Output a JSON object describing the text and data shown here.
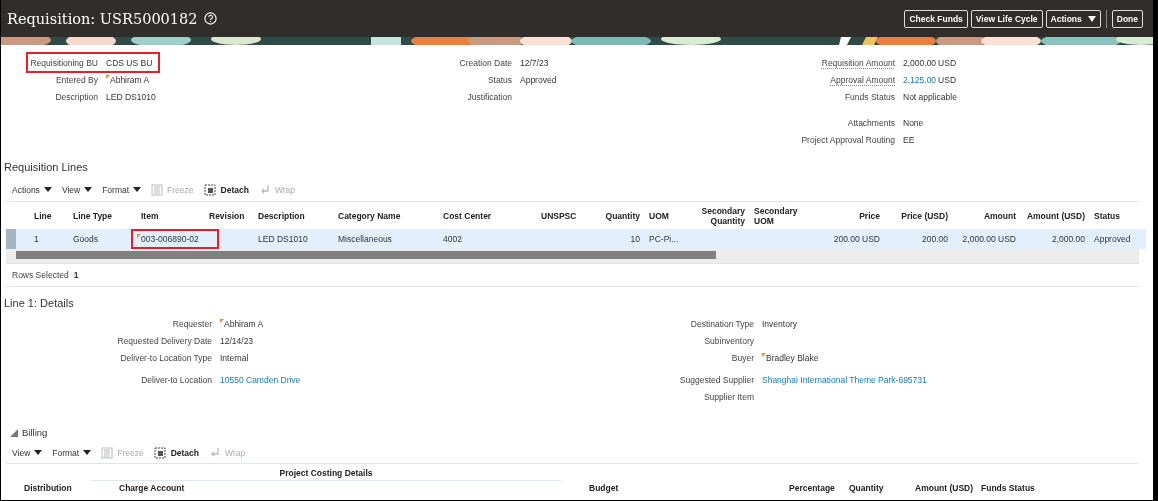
{
  "header": {
    "title": "Requisition: USR5000182",
    "buttons": [
      {
        "label": "Check Funds",
        "kind": "button"
      },
      {
        "label": "View Life Cycle",
        "kind": "button"
      },
      {
        "label": "Actions",
        "kind": "menu"
      },
      {
        "label": "Done",
        "kind": "button"
      }
    ]
  },
  "summary": {
    "columns": [
      [
        [
          {
            "label": "Requisitioning BU",
            "value": "CDS US BU",
            "kind": "text",
            "highlighted": true
          },
          {
            "label": "Entered By",
            "value": "Abhiram A",
            "kind": "person",
            "highlighted": false
          },
          {
            "label": "Description",
            "value": "LED DS1010",
            "kind": "text",
            "highlighted": false
          }
        ]
      ],
      [
        [
          {
            "label": "Creation Date",
            "value": "12/7/23",
            "kind": "text",
            "highlighted": false
          },
          {
            "label": "Status",
            "value": "Approved",
            "kind": "text",
            "highlighted": false
          },
          {
            "label": "Justification",
            "highlighted": false
          }
        ]
      ],
      [
        [
          {
            "label": "Requisition Amount",
            "value": "2,000.00",
            "currency": "USD",
            "kind": "amount",
            "hint": true,
            "highlighted": false
          },
          {
            "label": "Approval Amount",
            "value": "2,125.00",
            "currency": "USD",
            "kind": "amount_link",
            "hint": true,
            "highlighted": false
          },
          {
            "label": "Funds Status",
            "value": "Not applicable",
            "kind": "text",
            "highlighted": false
          }
        ],
        [
          {
            "label": "Attachments",
            "value": "None",
            "kind": "text",
            "highlighted": false
          },
          {
            "label": "Project Approval Routing",
            "value": "EE",
            "kind": "text",
            "highlighted": false
          }
        ]
      ]
    ]
  },
  "lines": {
    "title": "Requisition Lines",
    "toolbar": [
      {
        "label": "Actions",
        "kind": "menu",
        "disabled": false
      },
      {
        "label": "View",
        "kind": "menu",
        "disabled": false
      },
      {
        "label": "Format",
        "kind": "menu",
        "disabled": false
      },
      {
        "label": "Freeze",
        "kind": "freeze",
        "disabled": true
      },
      {
        "label": "Detach",
        "kind": "detach",
        "disabled": false
      },
      {
        "label": "Wrap",
        "kind": "wrap",
        "disabled": true
      }
    ],
    "columns": [
      {
        "label": "Line",
        "numeric": false
      },
      {
        "label": "Line Type",
        "numeric": false
      },
      {
        "label": "Item",
        "numeric": false
      },
      {
        "label": "Revision",
        "numeric": false
      },
      {
        "label": "Description",
        "numeric": false
      },
      {
        "label": "Category Name",
        "numeric": false
      },
      {
        "label": "Cost Center",
        "numeric": false
      },
      {
        "label": "UNSPSC",
        "numeric": false
      },
      {
        "label": "Quantity",
        "numeric": true
      },
      {
        "label": "UOM",
        "numeric": false
      },
      {
        "label": "Secondary Quantity",
        "numeric": true
      },
      {
        "label": "Secondary UOM",
        "numeric": false
      },
      {
        "label": "Price",
        "numeric": true
      },
      {
        "label": "Price (USD)",
        "numeric": true
      },
      {
        "label": "Amount",
        "numeric": true
      },
      {
        "label": "Amount (USD)",
        "numeric": true
      },
      {
        "label": "Status",
        "numeric": false
      }
    ],
    "rows": [
      {
        "selected": true,
        "cells": [
          {
            "text": "1"
          },
          {
            "text": "Goods"
          },
          {
            "text": "003-006890-02",
            "kind": "flagged",
            "highlighted": true
          },
          {},
          {
            "text": "LED DS1010"
          },
          {
            "text": "Miscellaneous"
          },
          {
            "text": "4002"
          },
          {},
          {
            "text": "10"
          },
          {
            "text": "PC-Pi..."
          },
          {},
          {},
          {
            "text": "200.00 USD"
          },
          {
            "text": "200.00"
          },
          {
            "text": "2,000.00 USD"
          },
          {
            "text": "2,000.00"
          },
          {
            "text": "Approved"
          }
        ]
      }
    ],
    "rows_selected": {
      "label": "Rows Selected",
      "value": "1"
    }
  },
  "details": {
    "title": "Line 1: Details",
    "columns": [
      [
        [
          {
            "label": "Requester",
            "value": "Abhiram A",
            "kind": "person",
            "highlighted": false
          },
          {
            "label": "Requested Delivery Date",
            "value": "12/14/23",
            "kind": "text",
            "highlighted": false
          },
          {
            "label": "Deliver-to Location Type",
            "value": "Internal",
            "kind": "text",
            "highlighted": false
          }
        ],
        [
          {
            "label": "Deliver-to Location",
            "value": "10550 Camden Drive",
            "kind": "link",
            "highlighted": false
          }
        ]
      ],
      [
        [
          {
            "label": "Destination Type",
            "value": "Inventory",
            "kind": "text",
            "highlighted": false
          },
          {
            "label": "Subinventory",
            "highlighted": false
          },
          {
            "label": "Buyer",
            "value": "Bradley Blake",
            "kind": "person",
            "highlighted": false
          }
        ],
        [
          {
            "label": "Suggested Supplier",
            "value": "Shanghai International Theme Park-695731",
            "kind": "link",
            "highlighted": false
          },
          {
            "label": "Supplier Item",
            "highlighted": false
          }
        ]
      ]
    ]
  },
  "billing": {
    "title": "Billing",
    "expanded": true,
    "toolbar": [
      {
        "label": "View",
        "kind": "menu",
        "disabled": false
      },
      {
        "label": "Format",
        "kind": "menu",
        "disabled": false
      },
      {
        "label": "Freeze",
        "kind": "freeze",
        "disabled": true
      },
      {
        "label": "Detach",
        "kind": "detach",
        "disabled": false
      },
      {
        "label": "Wrap",
        "kind": "wrap",
        "disabled": true
      }
    ],
    "group_header": "Project Costing Details",
    "columns": [
      "Distribution",
      "Charge Account",
      "Budget",
      "Percentage",
      "Quantity",
      "Amount (USD)",
      "Funds Status"
    ]
  }
}
